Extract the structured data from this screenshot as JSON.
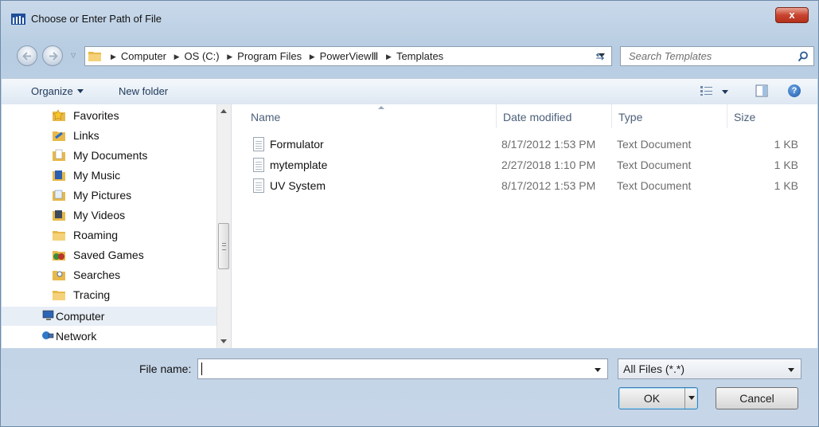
{
  "window": {
    "title": "Choose or Enter Path of File",
    "close_label": "x"
  },
  "address": {
    "crumbs": [
      "Computer",
      "OS (C:)",
      "Program Files",
      "PowerViewⅢ",
      "Templates"
    ]
  },
  "search": {
    "placeholder": "Search Templates"
  },
  "toolbar": {
    "organize_label": "Organize",
    "new_folder_label": "New folder"
  },
  "nav": {
    "items": [
      {
        "label": "Favorites",
        "icon": "star-folder-icon"
      },
      {
        "label": "Links",
        "icon": "links-folder-icon"
      },
      {
        "label": "My Documents",
        "icon": "documents-folder-icon"
      },
      {
        "label": "My Music",
        "icon": "music-folder-icon"
      },
      {
        "label": "My Pictures",
        "icon": "pictures-folder-icon"
      },
      {
        "label": "My Videos",
        "icon": "videos-folder-icon"
      },
      {
        "label": "Roaming",
        "icon": "folder-icon"
      },
      {
        "label": "Saved Games",
        "icon": "saved-games-icon"
      },
      {
        "label": "Searches",
        "icon": "searches-folder-icon"
      },
      {
        "label": "Tracing",
        "icon": "folder-icon"
      },
      {
        "label": "Computer",
        "icon": "computer-icon"
      },
      {
        "label": "Network",
        "icon": "network-icon"
      }
    ]
  },
  "columns": {
    "name": "Name",
    "date": "Date modified",
    "type": "Type",
    "size": "Size"
  },
  "files": [
    {
      "name": "Formulator",
      "date": "8/17/2012 1:53 PM",
      "type": "Text Document",
      "size": "1 KB"
    },
    {
      "name": "mytemplate",
      "date": "2/27/2018 1:10 PM",
      "type": "Text Document",
      "size": "1 KB"
    },
    {
      "name": "UV System",
      "date": "8/17/2012 1:53 PM",
      "type": "Text Document",
      "size": "1 KB"
    }
  ],
  "footer": {
    "file_name_label": "File name:",
    "file_name_value": "",
    "file_type": "All Files (*.*)",
    "ok_label": "OK",
    "cancel_label": "Cancel"
  }
}
